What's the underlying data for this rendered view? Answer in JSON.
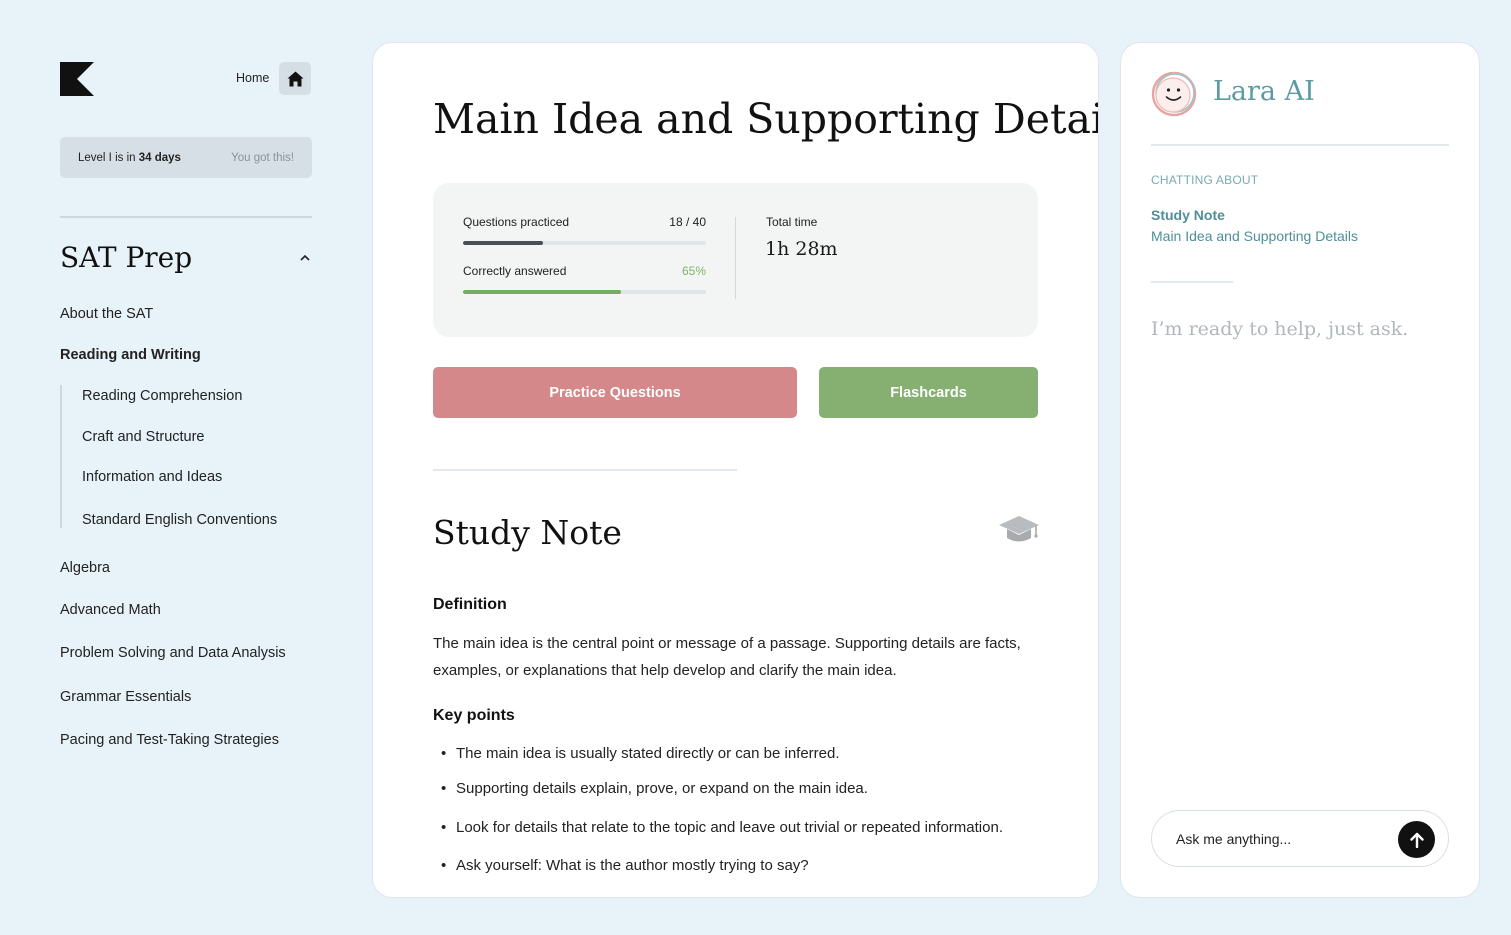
{
  "sidebar": {
    "home_label": "Home",
    "level_text_prefix": "Level I is in ",
    "level_days": "34 days",
    "level_encouragement": "You got this!",
    "section_title": "SAT Prep",
    "items": [
      {
        "label": "About the SAT"
      },
      {
        "label": "Reading and Writing"
      },
      {
        "label": "Algebra"
      },
      {
        "label": "Advanced Math"
      },
      {
        "label": "Problem Solving and Data Analysis"
      },
      {
        "label": "Grammar Essentials"
      },
      {
        "label": "Pacing and Test-Taking Strategies"
      }
    ],
    "sub_items": [
      {
        "label": "Reading Comprehension"
      },
      {
        "label": "Craft and Structure"
      },
      {
        "label": "Information and Ideas"
      },
      {
        "label": "Standard English Conventions"
      }
    ]
  },
  "main": {
    "title": "Main Idea and Supporting Details",
    "stats": {
      "questions_label": "Questions practiced",
      "questions_value": "18 / 40",
      "questions_progress": 0.33,
      "correct_label": "Correctly answered",
      "correct_value": "65%",
      "correct_progress": 0.65,
      "time_label": "Total time",
      "time_value": "1h 28m"
    },
    "practice_button": "Practice Questions",
    "flashcards_button": "Flashcards",
    "note_title": "Study Note",
    "definition_heading": "Definition",
    "definition_text": "The main idea is the central point or message of a passage. Supporting details are facts, examples, or explanations that help develop and clarify the main idea.",
    "keypoints_heading": "Key points",
    "key_points": [
      "The main idea is usually stated directly or can be inferred.",
      "Supporting details explain, prove, or expand on the main idea.",
      "Look for details that relate to the topic and leave out trivial or repeated information.",
      "Ask yourself: What is the author mostly trying to say?"
    ]
  },
  "chat": {
    "name": "Lara AI",
    "about_label": "CHATTING ABOUT",
    "about_type": "Study Note",
    "about_topic": "Main Idea and Supporting Details",
    "hint": "I’m ready to help, just ask.",
    "input_placeholder": "Ask me anything..."
  },
  "icons": {
    "logo": "brand-logo-icon",
    "home": "home-icon",
    "caret": "chevron-up-icon",
    "graduation": "graduation-cap-icon",
    "avatar": "smiley-face-icon",
    "send": "arrow-up-icon"
  },
  "colors": {
    "background": "#e8f3f9",
    "practice_button": "#d4888a",
    "flashcards_button": "#85b072",
    "progress_dark": "#4a4f55",
    "progress_green": "#72ad62",
    "percent_green": "#7cb46c",
    "accent_teal": "#5c9aa4"
  }
}
